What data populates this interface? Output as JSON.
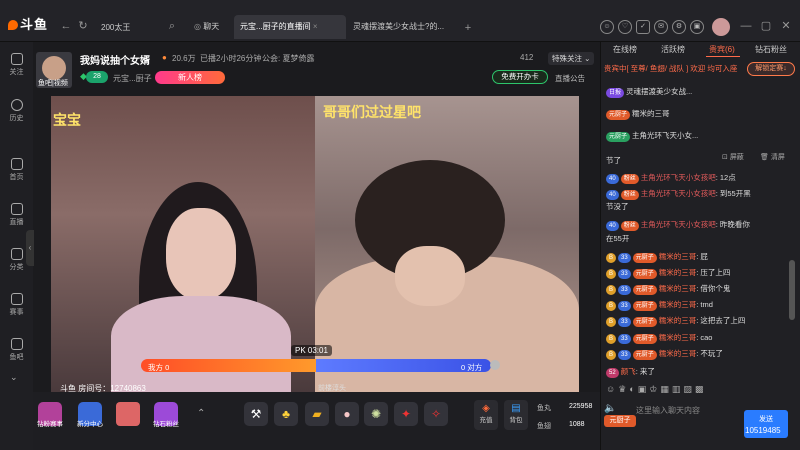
{
  "topbar": {
    "logo": "斗鱼",
    "search_text": "200太王",
    "tab_chat": "聊天",
    "tab_room": "元宝...厨子的直播间",
    "tab_other": "灵魂摆渡美少女战士?的..."
  },
  "sidebar": {
    "items": [
      {
        "label": "关注",
        "icon": "heart-icon"
      },
      {
        "label": "历史",
        "icon": "clock-icon"
      },
      {
        "label": "首页",
        "icon": "home-icon"
      },
      {
        "label": "直播",
        "icon": "tv-icon"
      },
      {
        "label": "分类",
        "icon": "grid-icon"
      },
      {
        "label": "赛事",
        "icon": "trophy-icon"
      },
      {
        "label": "鱼吧",
        "icon": "fish-icon"
      }
    ]
  },
  "room": {
    "title": "我妈说抽个女婿",
    "hot": "20.6万",
    "live_time": "已播2小时26分钟",
    "guild": "公会: 夏梦倚露",
    "count_412": "412",
    "special_follow": "特殊关注",
    "level": "28",
    "owner": "元宝...厨子",
    "new_pill": "新人榜",
    "free_start": "免费开办卡",
    "announce": "直播公告",
    "avatar_caption": "鱼吧|视频"
  },
  "video": {
    "caption_left": "宝宝",
    "caption_right": "哥哥们过过星吧",
    "pk_timer": "PK 03:01",
    "pk_left": "我方 0",
    "pk_right": "0 对方",
    "room_id": "斗鱼 房间号：12740863",
    "room_id_right": "前楼淳头"
  },
  "giftbar": {
    "gifts": [
      {
        "label": "钻粉赛事"
      },
      {
        "label": "新分中心"
      },
      {
        "label": ""
      },
      {
        "label": "钻石粉丝"
      }
    ],
    "charge": "充值",
    "backpack": "背包",
    "yuwan_label": "鱼丸",
    "yuwan_value": "225958",
    "yuchi_label": "鱼翅",
    "yuchi_value": "1088"
  },
  "rightpanel": {
    "tabs": [
      "在线榜",
      "活跃榜",
      "贵宾(6)",
      "钻石粉丝"
    ],
    "notice": "贵宾中[ 至尊/ 鱼翅/ 战队 ] 欢迎 均可入座",
    "unlock": "解锁定赛↓",
    "top_msgs": [
      {
        "tag": "日报",
        "text": "灵魂摆渡美少女战..."
      },
      {
        "tag": "元厨子",
        "text": "糯米的三哥"
      },
      {
        "tag": "元厨子",
        "text": "主角光环飞天小女..."
      }
    ],
    "shield": "屏蔽",
    "clear": "清屏",
    "msgs": [
      {
        "user": "",
        "text": "节了"
      },
      {
        "user": "主角光环飞天小女孩吧",
        "text": "12点"
      },
      {
        "user": "主角光环飞天小女孩吧",
        "text": "到55开黑"
      },
      {
        "user": "",
        "text": "节没了"
      },
      {
        "user": "主角光环飞天小女孩吧",
        "text": "昨晚看你"
      },
      {
        "user": "",
        "text": "在55开"
      },
      {
        "user": "糯米的三哥",
        "text": "屁"
      },
      {
        "user": "糯米的三哥",
        "text": "压了上四"
      },
      {
        "user": "糯米的三哥",
        "text": "借你个鬼"
      },
      {
        "user": "糯米的三哥",
        "text": "tmd"
      },
      {
        "user": "糯米的三哥",
        "text": "这把去了上四"
      },
      {
        "user": "糯米的三哥",
        "text": "cao"
      },
      {
        "user": "糯米的三哥",
        "text": "不玩了"
      },
      {
        "user": "颜飞",
        "text": "来了"
      }
    ],
    "input_placeholder": "这里输入聊天内容",
    "viewers": "10519485",
    "send_label": "发送"
  }
}
